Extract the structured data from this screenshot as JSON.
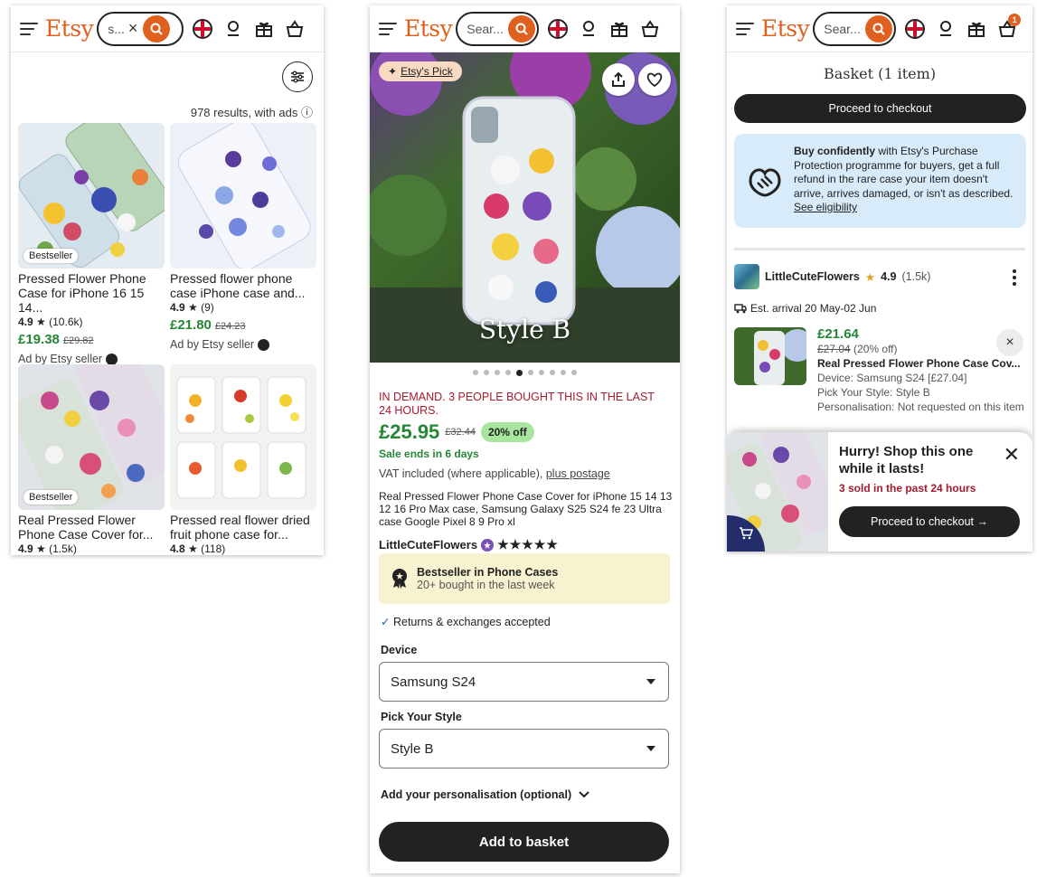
{
  "brand": {
    "logo": "Etsy",
    "accent": "#e0601f",
    "green": "#258635",
    "demand_red": "#a61a2e"
  },
  "screen1": {
    "search_text": "s...",
    "results_text": "978 results, with ads",
    "cards": [
      {
        "badge": "Bestseller",
        "title": "Pressed Flower Phone Case for iPhone 16 15 14...",
        "rating": "4.9",
        "reviews": "(10.6k)",
        "price": "£19.38",
        "old_price": "£29.82",
        "ad": "Ad by Etsy seller"
      },
      {
        "badge": "",
        "title": "Pressed flower phone case iPhone case and...",
        "rating": "4.9",
        "reviews": "(9)",
        "price": "£21.80",
        "old_price": "£24.23",
        "ad": "Ad by Etsy seller"
      },
      {
        "badge": "Bestseller",
        "title": "Real Pressed Flower Phone Case Cover for...",
        "rating": "4.9",
        "reviews": "(1.5k)"
      },
      {
        "badge": "",
        "title": "Pressed real flower dried fruit phone case for...",
        "rating": "4.8",
        "reviews": "(118)"
      }
    ]
  },
  "screen2": {
    "search_placeholder": "Sear...",
    "etsys_pick": "Etsy's Pick",
    "image_caption": "Style B",
    "demand": "IN DEMAND. 3 PEOPLE BOUGHT THIS IN THE LAST 24 HOURS.",
    "price": "£25.95",
    "old_price": "£32.44",
    "discount": "20% off",
    "sale_ends": "Sale ends in 6 days",
    "vat": "VAT included (where applicable),",
    "postage_link": "plus postage",
    "title": "Real Pressed Flower Phone Case Cover for iPhone 15 14 13 12 16 Pro Max case, Samsung Galaxy S25 S24 fe 23 Ultra case Google Pixel 8 9 Pro xl",
    "shop_name": "LittleCuteFlowers",
    "stars": "★★★★★",
    "bestseller_title": "Bestseller in Phone Cases",
    "bestseller_sub": "20+ bought in the last week",
    "returns": "Returns & exchanges accepted",
    "device_label": "Device",
    "device_value": "Samsung S24",
    "style_label": "Pick Your Style",
    "style_value": "Style B",
    "personalisation": "Add your personalisation (optional)",
    "add_to_basket": "Add to basket",
    "carousel_count": 10,
    "carousel_active": 4
  },
  "screen3": {
    "search_placeholder": "Sear...",
    "cart_count": "1",
    "basket_title": "Basket (1 item)",
    "checkout": "Proceed to checkout",
    "protect_bold": "Buy confidently",
    "protect_text": " with Etsy's Purchase Protection programme for buyers, get a full refund in the rare case your item doesn't arrive, arrives damaged, or isn't as described. ",
    "protect_link": "See eligibility",
    "seller_name": "LittleCuteFlowers",
    "seller_rating": "4.9",
    "seller_reviews": "(1.5k)",
    "arrival": "Est. arrival 20 May-02 Jun",
    "item_price": "£21.64",
    "item_old_price": "£27.04",
    "item_off": "(20% off)",
    "item_title": "Real Pressed Flower Phone Case Cov...",
    "item_device": "Device: Samsung S24 [£27.04]",
    "item_style": "Pick Your Style: Style B",
    "item_personal": "Personalisation: Not requested on this item",
    "popup_title": "Hurry! Shop this one while it lasts!",
    "popup_sold": "3 sold in the past 24 hours",
    "popup_checkout": "Proceed to checkout →"
  }
}
